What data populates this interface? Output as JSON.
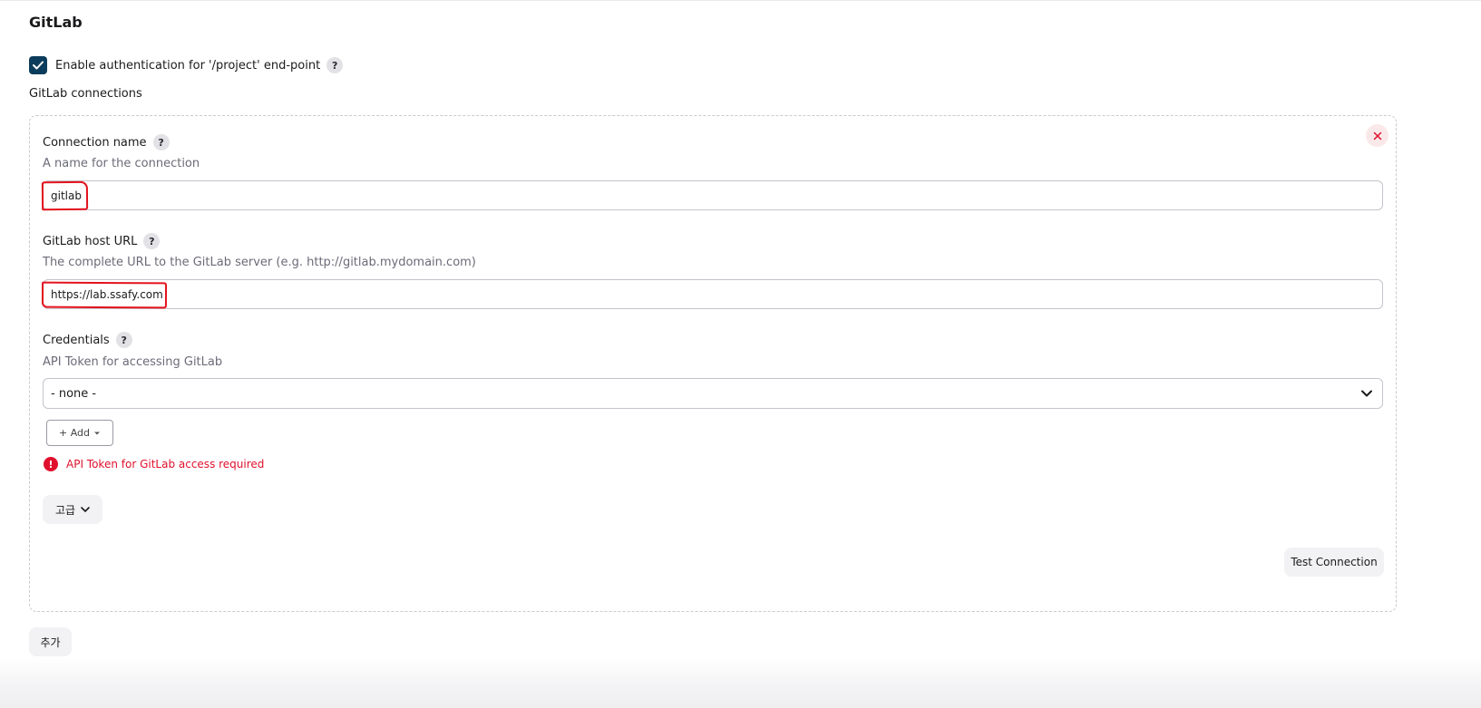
{
  "section": {
    "title": "GitLab"
  },
  "auth": {
    "checkbox_label": "Enable authentication for '/project' end-point",
    "checked": true
  },
  "connections": {
    "label": "GitLab connections"
  },
  "connection": {
    "name": {
      "label": "Connection name",
      "description": "A name for the connection",
      "value": "gitlab"
    },
    "host_url": {
      "label": "GitLab host URL",
      "description": "The complete URL to the GitLab server (e.g. http://gitlab.mydomain.com)",
      "value": "https://lab.ssafy.com"
    },
    "credentials": {
      "label": "Credentials",
      "description": "API Token for accessing GitLab",
      "selected": "- none -",
      "add_label": "+ Add"
    },
    "error": {
      "icon_glyph": "!",
      "text": "API Token for GitLab access required"
    },
    "advanced_label": "고급",
    "test_label": "Test Connection"
  },
  "help_glyph": "?",
  "add_connection_label": "추가",
  "colors": {
    "checkbox": "#0c3c5c",
    "error": "#e0102d",
    "annotation": "#e3121c"
  },
  "icons": {
    "checkbox": "check-icon",
    "delete": "close-icon",
    "select": "chevron-down-icon",
    "add_caret": "caret-down-icon",
    "advanced": "chevron-down-icon",
    "error": "exclamation-circle-icon",
    "help": "question-mark-icon"
  }
}
